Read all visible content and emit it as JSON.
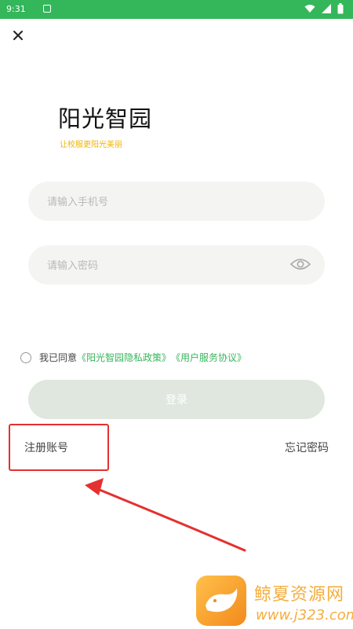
{
  "status_bar": {
    "time": "9:31"
  },
  "header": {
    "close_icon": "close-icon"
  },
  "brand": {
    "title": "阳光智园",
    "slogan": "让校服更阳光美丽"
  },
  "form": {
    "phone_placeholder": "请输入手机号",
    "password_placeholder": "请输入密码",
    "agreement_prefix": "我已同意",
    "privacy_link": "《阳光智园隐私政策》",
    "terms_link": "《用户服务协议》",
    "login_label": "登录"
  },
  "links": {
    "register": "注册账号",
    "forgot_password": "忘记密码"
  },
  "watermark": {
    "name": "鲸夏资源网",
    "url": "www.j323.com"
  },
  "colors": {
    "status_bar": "#33b75a",
    "accent_green": "#36b65b",
    "slogan_gold": "#f0b400",
    "login_button_disabled": "#dfe7df",
    "annotation_red": "#e53030"
  }
}
